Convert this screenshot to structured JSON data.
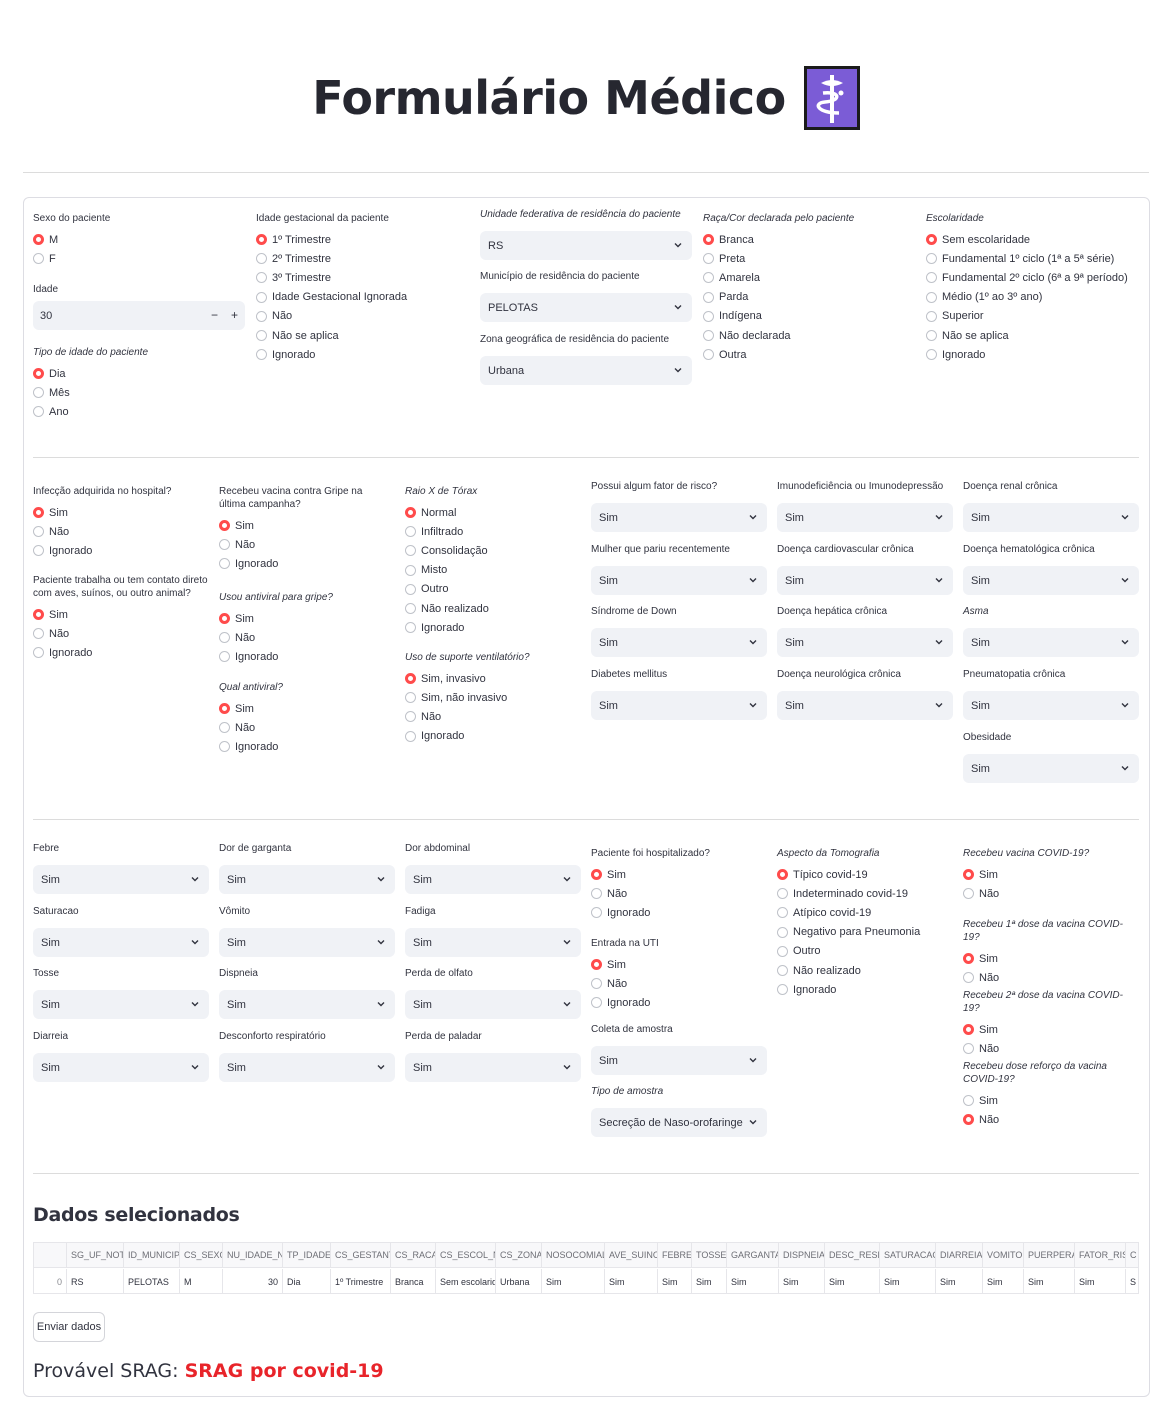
{
  "title": "Formulário Médico",
  "title_icon": "medical-caduceus-icon",
  "accent_color": "#ff4b4b",
  "section1": {
    "sexo": {
      "label": "Sexo do paciente",
      "options": [
        "M",
        "F"
      ],
      "selected": 0
    },
    "idade": {
      "label": "Idade",
      "value": "30",
      "minus": "−",
      "plus": "+"
    },
    "tipo_idade": {
      "label": "Tipo de idade do paciente",
      "options": [
        "Dia",
        "Mês",
        "Ano"
      ],
      "selected": 0
    },
    "gestacional": {
      "label": "Idade gestacional da paciente",
      "options": [
        "1º Trimestre",
        "2º Trimestre",
        "3º Trimestre",
        "Idade Gestacional Ignorada",
        "Não",
        "Não se aplica",
        "Ignorado"
      ],
      "selected": 0
    },
    "uf": {
      "label": "Unidade federativa de residência do paciente",
      "value": "RS"
    },
    "municipio": {
      "label": "Município de residência do paciente",
      "value": "PELOTAS"
    },
    "zona": {
      "label": "Zona geográfica de residência do paciente",
      "value": "Urbana"
    },
    "raca": {
      "label": "Raça/Cor declarada pelo paciente",
      "options": [
        "Branca",
        "Preta",
        "Amarela",
        "Parda",
        "Indígena",
        "Não declarada",
        "Outra"
      ],
      "selected": 0
    },
    "escolaridade": {
      "label": "Escolaridade",
      "options": [
        "Sem escolaridade",
        "Fundamental 1º ciclo (1ª a 5ª série)",
        "Fundamental 2º ciclo (6ª a 9ª período)",
        "Médio (1º ao 3º ano)",
        "Superior",
        "Não se aplica",
        "Ignorado"
      ],
      "selected": 0
    }
  },
  "section2": {
    "nosocomial": {
      "label": "Infecção adquirida no hospital?",
      "options": [
        "Sim",
        "Não",
        "Ignorado"
      ],
      "selected": 0
    },
    "animal": {
      "label": "Paciente trabalha ou tem contato direto com aves, suínos, ou outro animal?",
      "options": [
        "Sim",
        "Não",
        "Ignorado"
      ],
      "selected": 0
    },
    "vacina_gripe": {
      "label": "Recebeu vacina contra Gripe na última campanha?",
      "options": [
        "Sim",
        "Não",
        "Ignorado"
      ],
      "selected": 0
    },
    "antiviral": {
      "label": "Usou antiviral para gripe?",
      "options": [
        "Sim",
        "Não",
        "Ignorado"
      ],
      "selected": 0
    },
    "qual_antiviral": {
      "label": "Qual antiviral?",
      "options": [
        "Sim",
        "Não",
        "Ignorado"
      ],
      "selected": 0
    },
    "raio_x": {
      "label": "Raio X de Tórax",
      "options": [
        "Normal",
        "Infiltrado",
        "Consolidação",
        "Misto",
        "Outro",
        "Não realizado",
        "Ignorado"
      ],
      "selected": 0
    },
    "suporte": {
      "label": "Uso de suporte ventilatório?",
      "options": [
        "Sim, invasivo",
        "Sim, não invasivo",
        "Não",
        "Ignorado"
      ],
      "selected": 0
    },
    "selects": [
      {
        "label": "Possui algum fator de risco?",
        "value": "Sim"
      },
      {
        "label": "Mulher que pariu recentemente",
        "value": "Sim"
      },
      {
        "label": "Síndrome de Down",
        "value": "Sim"
      },
      {
        "label": "Diabetes mellitus",
        "value": "Sim"
      },
      {
        "label": "Imunodeficiência ou Imunodepressão",
        "value": "Sim"
      },
      {
        "label": "Doença cardiovascular crônica",
        "value": "Sim"
      },
      {
        "label": "Doença hepática crônica",
        "value": "Sim"
      },
      {
        "label": "Doença neurológica crônica",
        "value": "Sim"
      },
      {
        "label": "Doença renal crônica",
        "value": "Sim"
      },
      {
        "label": "Doença hematológica crônica",
        "value": "Sim"
      },
      {
        "label": "Asma",
        "value": "Sim"
      },
      {
        "label": "Pneumatopatia crônica",
        "value": "Sim"
      },
      {
        "label": "Obesidade",
        "value": "Sim"
      }
    ]
  },
  "section3": {
    "selects": [
      {
        "label": "Febre",
        "value": "Sim"
      },
      {
        "label": "Saturacao",
        "value": "Sim"
      },
      {
        "label": "Tosse",
        "value": "Sim"
      },
      {
        "label": "Diarreia",
        "value": "Sim"
      },
      {
        "label": "Dor de garganta",
        "value": "Sim"
      },
      {
        "label": "Vômito",
        "value": "Sim"
      },
      {
        "label": "Dispneia",
        "value": "Sim"
      },
      {
        "label": "Desconforto respiratório",
        "value": "Sim"
      },
      {
        "label": "Dor abdominal",
        "value": "Sim"
      },
      {
        "label": "Fadiga",
        "value": "Sim"
      },
      {
        "label": "Perda de olfato",
        "value": "Sim"
      },
      {
        "label": "Perda de paladar",
        "value": "Sim"
      }
    ],
    "hospitalizado": {
      "label": "Paciente foi hospitalizado?",
      "options": [
        "Sim",
        "Não",
        "Ignorado"
      ],
      "selected": 0
    },
    "uti": {
      "label": "Entrada na UTI",
      "options": [
        "Sim",
        "Não",
        "Ignorado"
      ],
      "selected": 0
    },
    "coleta": {
      "label": "Coleta de amostra",
      "value": "Sim"
    },
    "tipo_amostra": {
      "label": "Tipo de amostra",
      "value": "Secreção de Naso-orofaringe"
    },
    "tomografia": {
      "label": "Aspecto da Tomografia",
      "options": [
        "Típico covid-19",
        "Indeterminado covid-19",
        "Atípico covid-19",
        "Negativo para Pneumonia",
        "Outro",
        "Não realizado",
        "Ignorado"
      ],
      "selected": 0
    },
    "vacina_covid": {
      "label": "Recebeu vacina COVID-19?",
      "options": [
        "Sim",
        "Não"
      ],
      "selected": 0
    },
    "dose1": {
      "label": "Recebeu 1ª dose da vacina COVID-19?",
      "options": [
        "Sim",
        "Não"
      ],
      "selected": 0
    },
    "dose2": {
      "label": "Recebeu 2ª dose da vacina COVID-19?",
      "options": [
        "Sim",
        "Não"
      ],
      "selected": 0
    },
    "reforco": {
      "label": "Recebeu dose reforço da vacina COVID-19?",
      "options": [
        "Sim",
        "Não"
      ],
      "selected": 1
    }
  },
  "dados": {
    "title": "Dados selecionados",
    "columns": [
      "",
      "SG_UF_NOT",
      "ID_MUNICIP",
      "CS_SEXO",
      "NU_IDADE_N",
      "TP_IDADE",
      "CS_GESTANT",
      "CS_RACA",
      "CS_ESCOL_N",
      "CS_ZONA",
      "NOSOCOMIAL",
      "AVE_SUINO",
      "FEBRE",
      "TOSSE",
      "GARGANTA",
      "DISPNEIA",
      "DESC_RESP",
      "SATURACAO",
      "DIARREIA",
      "VOMITO",
      "PUERPERA",
      "FATOR_RISC",
      "C"
    ],
    "row": [
      "0",
      "RS",
      "PELOTAS",
      "M",
      "30",
      "Dia",
      "1º Trimestre",
      "Branca",
      "Sem escolarida",
      "Urbana",
      "Sim",
      "Sim",
      "Sim",
      "Sim",
      "Sim",
      "Sim",
      "Sim",
      "Sim",
      "Sim",
      "Sim",
      "Sim",
      "Sim",
      "S"
    ]
  },
  "submit_label": "Enviar dados",
  "result": {
    "prefix": "Provável SRAG:",
    "value": "SRAG por covid-19",
    "value_color": "#e8242a"
  }
}
